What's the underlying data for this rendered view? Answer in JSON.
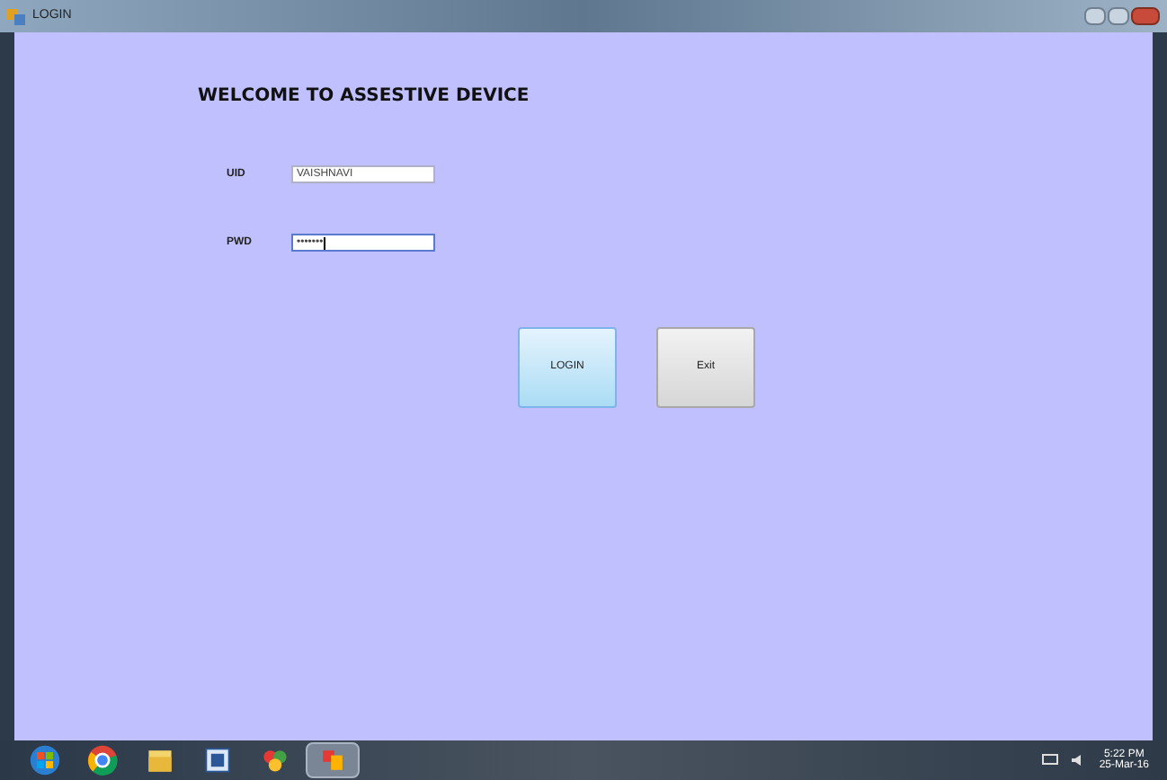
{
  "window": {
    "title": "LOGIN"
  },
  "heading": "WELCOME TO ASSESTIVE DEVICE",
  "fields": [
    {
      "label": "UID",
      "value": "VAISHNAVI",
      "focused": false
    },
    {
      "label": "PWD",
      "value": "•••••••",
      "focused": true
    }
  ],
  "buttons": [
    {
      "label": "LOGIN",
      "kind": "primary"
    },
    {
      "label": "Exit",
      "kind": "default"
    }
  ],
  "taskbar": {
    "apps": [
      {
        "kind": "start",
        "selected": false
      },
      {
        "kind": "browser",
        "selected": false
      },
      {
        "kind": "folder",
        "selected": false
      },
      {
        "kind": "document",
        "selected": false
      },
      {
        "kind": "paint",
        "selected": false
      },
      {
        "kind": "app",
        "selected": true
      }
    ],
    "time": "5:22 PM",
    "date": "25-Mar-16"
  }
}
